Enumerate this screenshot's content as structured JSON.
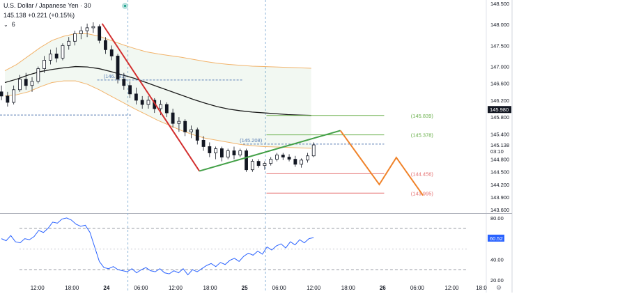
{
  "header": {
    "symbol_label": "U.S. Dollar / Japanese Yen · 30",
    "price": "145.138",
    "change": "+0.221 (+0.15%)",
    "indicator_count": "6"
  },
  "colors": {
    "down": "#d32f2f",
    "up": "#43a047",
    "forecast": "#f0832a",
    "sma": "#1a1a1a",
    "band": "#f2b36a",
    "rsi": "#2962ff",
    "level_green": "#6ab04c",
    "level_red": "#e57373"
  },
  "chart_data": [
    {
      "type": "candlestick",
      "y_ticks": [
        "148.500",
        "148.000",
        "147.500",
        "147.000",
        "146.600",
        "146.200",
        "145.800",
        "145.400",
        "145.138",
        "144.800",
        "144.500",
        "144.200",
        "143.900",
        "143.600"
      ],
      "x_ticks": [
        "12:00",
        "18:00",
        "24",
        "06:00",
        "12:00",
        "18:00",
        "25",
        "06:00",
        "12:00",
        "18:00",
        "26",
        "06:00",
        "12:00",
        "18:0"
      ],
      "ylim": [
        143.52,
        148.58
      ],
      "current_price": "145.980",
      "current_price_label": "145.138",
      "countdown": "03:10",
      "price_labels": [
        {
          "text": "(146.731)",
          "value": 146.731
        },
        {
          "text": "(145.208)",
          "value": 145.208
        }
      ],
      "levels": [
        {
          "text": "(145.839)",
          "value": 145.839,
          "kind": "green"
        },
        {
          "text": "(145.378)",
          "value": 145.378,
          "kind": "green"
        },
        {
          "text": "(144.456)",
          "value": 144.456,
          "kind": "red"
        },
        {
          "text": "(143.995)",
          "value": 143.995,
          "kind": "red"
        }
      ],
      "trend_down": {
        "from": [
          0.21,
          148.02
        ],
        "to": [
          0.41,
          144.52
        ]
      },
      "trend_up": {
        "from": [
          0.41,
          144.52
        ],
        "to": [
          0.7,
          145.48
        ]
      },
      "forecast": [
        [
          0.7,
          145.48
        ],
        [
          0.78,
          144.2
        ],
        [
          0.815,
          144.84
        ],
        [
          0.87,
          143.94
        ]
      ],
      "candles": [
        [
          146.4,
          146.55,
          146.2,
          146.3
        ],
        [
          146.3,
          146.4,
          146.05,
          146.15
        ],
        [
          146.15,
          146.55,
          146.1,
          146.45
        ],
        [
          146.45,
          146.8,
          146.4,
          146.7
        ],
        [
          146.7,
          146.85,
          146.45,
          146.55
        ],
        [
          146.55,
          146.75,
          146.4,
          146.65
        ],
        [
          146.65,
          147.0,
          146.6,
          146.95
        ],
        [
          146.95,
          147.25,
          146.85,
          147.15
        ],
        [
          147.15,
          147.4,
          147.05,
          147.3
        ],
        [
          147.3,
          147.45,
          147.1,
          147.2
        ],
        [
          147.2,
          147.55,
          147.15,
          147.5
        ],
        [
          147.5,
          147.7,
          147.4,
          147.6
        ],
        [
          147.6,
          147.85,
          147.5,
          147.78
        ],
        [
          147.78,
          147.95,
          147.65,
          147.85
        ],
        [
          147.85,
          148.02,
          147.7,
          147.92
        ],
        [
          147.92,
          148.05,
          147.8,
          147.95
        ],
        [
          147.95,
          148.0,
          147.55,
          147.62
        ],
        [
          147.62,
          147.7,
          147.3,
          147.4
        ],
        [
          147.4,
          147.5,
          147.15,
          147.25
        ],
        [
          147.25,
          147.3,
          146.6,
          146.7
        ],
        [
          146.7,
          146.85,
          146.45,
          146.55
        ],
        [
          146.55,
          146.65,
          146.25,
          146.35
        ],
        [
          146.35,
          146.5,
          146.1,
          146.2
        ],
        [
          146.2,
          146.3,
          146.0,
          146.1
        ],
        [
          146.1,
          146.3,
          146.0,
          146.2
        ],
        [
          146.2,
          146.25,
          145.9,
          146.0
        ],
        [
          146.0,
          146.2,
          145.85,
          146.1
        ],
        [
          146.1,
          146.15,
          145.8,
          145.9
        ],
        [
          145.9,
          146.0,
          145.55,
          145.65
        ],
        [
          145.65,
          145.8,
          145.45,
          145.7
        ],
        [
          145.7,
          145.75,
          145.35,
          145.45
        ],
        [
          145.45,
          145.6,
          145.3,
          145.5
        ],
        [
          145.5,
          145.55,
          145.15,
          145.25
        ],
        [
          145.25,
          145.35,
          145.0,
          145.1
        ],
        [
          145.1,
          145.2,
          144.85,
          144.95
        ],
        [
          144.95,
          145.1,
          144.8,
          145.05
        ],
        [
          145.05,
          145.1,
          144.75,
          144.85
        ],
        [
          144.85,
          145.05,
          144.8,
          145.0
        ],
        [
          145.0,
          145.1,
          144.8,
          144.9
        ],
        [
          144.9,
          145.05,
          144.85,
          145.0
        ],
        [
          145.0,
          145.05,
          144.5,
          144.55
        ],
        [
          144.55,
          144.8,
          144.5,
          144.75
        ],
        [
          144.75,
          144.8,
          144.6,
          144.65
        ],
        [
          144.65,
          144.75,
          144.55,
          144.7
        ],
        [
          144.7,
          144.85,
          144.65,
          144.8
        ],
        [
          144.8,
          144.95,
          144.75,
          144.9
        ],
        [
          144.9,
          144.95,
          144.78,
          144.85
        ],
        [
          144.85,
          144.92,
          144.75,
          144.8
        ],
        [
          144.8,
          144.88,
          144.62,
          144.68
        ],
        [
          144.68,
          144.82,
          144.6,
          144.78
        ],
        [
          144.78,
          144.95,
          144.72,
          144.88
        ],
        [
          144.88,
          145.2,
          144.85,
          145.14
        ]
      ],
      "sma": [
        146.62,
        146.7,
        146.8,
        146.88,
        146.93,
        146.97,
        147.0,
        146.99,
        146.95,
        146.88,
        146.8,
        146.72,
        146.62,
        146.52,
        146.42,
        146.32,
        146.22,
        146.13,
        146.05,
        145.99,
        145.95,
        145.92,
        145.9,
        145.88,
        145.86,
        145.85,
        145.84
      ],
      "band_upper": [
        146.9,
        147.05,
        147.25,
        147.45,
        147.62,
        147.72,
        147.78,
        147.78,
        147.72,
        147.62,
        147.52,
        147.43,
        147.35,
        147.3,
        147.26,
        147.22,
        147.17,
        147.12,
        147.08,
        147.05,
        147.03,
        147.01,
        147.0,
        146.99,
        146.98,
        146.97,
        146.96
      ],
      "band_lower": [
        146.3,
        146.33,
        146.4,
        146.52,
        146.62,
        146.66,
        146.66,
        146.58,
        146.45,
        146.3,
        146.15,
        146.0,
        145.86,
        145.72,
        145.6,
        145.48,
        145.38,
        145.3,
        145.25,
        145.2,
        145.15,
        145.12,
        145.1,
        145.09,
        145.08,
        145.07,
        145.06
      ]
    },
    {
      "type": "line",
      "y_ticks": [
        "80.00",
        "60.00",
        "40.00",
        "20.00"
      ],
      "ylim": [
        18,
        84
      ],
      "current_label": "60.52",
      "guide_levels": [
        70,
        30
      ],
      "values": [
        60,
        58,
        63,
        57,
        56,
        60,
        59,
        62,
        68,
        66,
        70,
        76,
        75,
        79,
        80,
        78,
        74,
        72,
        73,
        66,
        52,
        38,
        32,
        31,
        33,
        30,
        29,
        28,
        31,
        27,
        30,
        32,
        29,
        28,
        31,
        27,
        26,
        29,
        27,
        31,
        25,
        30,
        28,
        31,
        34,
        36,
        33,
        37,
        35,
        39,
        41,
        38,
        43,
        46,
        44,
        48,
        45,
        52,
        49,
        53,
        55,
        51,
        57,
        54,
        59,
        56,
        60,
        61
      ]
    }
  ]
}
